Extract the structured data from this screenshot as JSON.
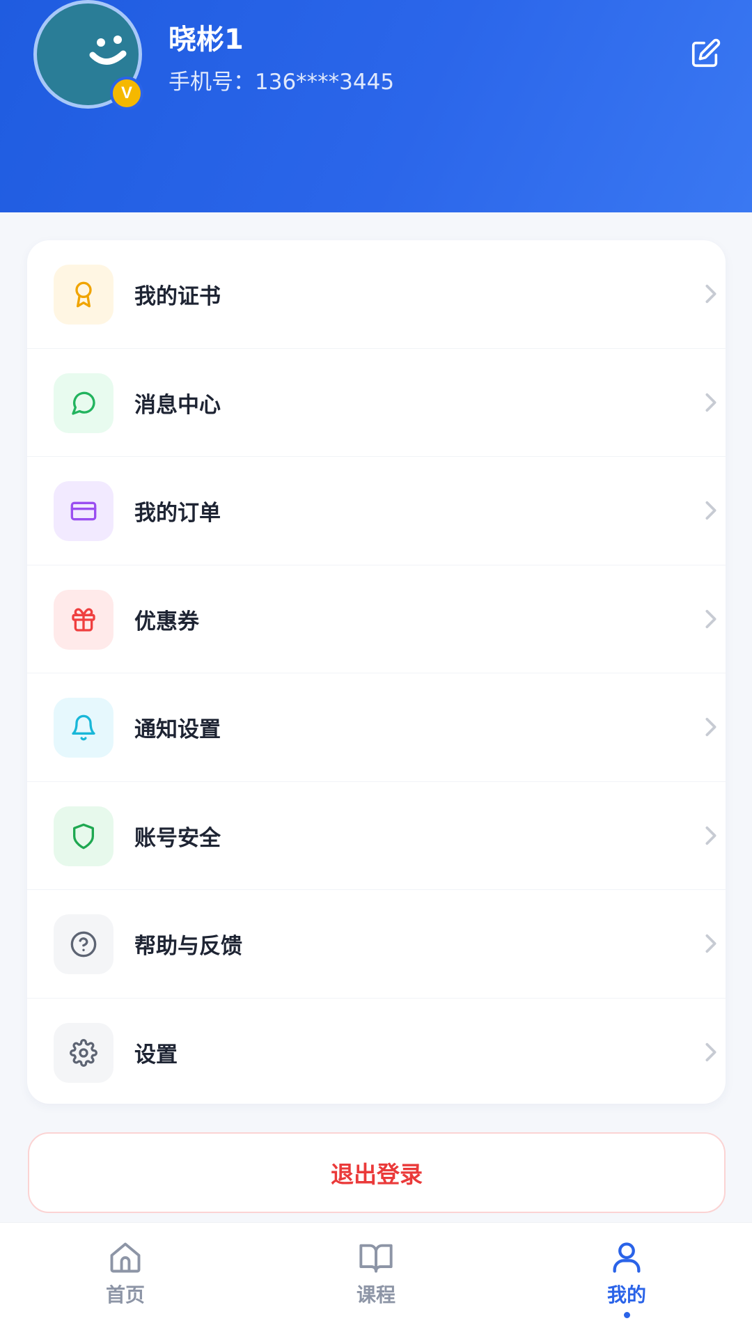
{
  "header": {
    "username": "晓彬1",
    "phone": "手机号：136****3445",
    "vip_badge": "V"
  },
  "menu": {
    "items": [
      {
        "label": "我的证书",
        "icon": "certificate-icon",
        "bg": "#fff6e3",
        "color": "#f0a400"
      },
      {
        "label": "消息中心",
        "icon": "chat-bubble-icon",
        "bg": "#e8fbef",
        "color": "#22b35e"
      },
      {
        "label": "我的订单",
        "icon": "credit-card-icon",
        "bg": "#f2eaff",
        "color": "#9a4ef0"
      },
      {
        "label": "优惠券",
        "icon": "gift-icon",
        "bg": "#ffeaea",
        "color": "#ef3f3f"
      },
      {
        "label": "通知设置",
        "icon": "bell-icon",
        "bg": "#e6f8fd",
        "color": "#19b7d8"
      },
      {
        "label": "账号安全",
        "icon": "shield-icon",
        "bg": "#e7f9ec",
        "color": "#1fa851"
      },
      {
        "label": "帮助与反馈",
        "icon": "help-circle-icon",
        "bg": "#f4f5f7",
        "color": "#5d6473"
      },
      {
        "label": "设置",
        "icon": "gear-icon",
        "bg": "#f4f5f7",
        "color": "#5d6473"
      }
    ]
  },
  "logout_label": "退出登录",
  "tabbar": {
    "tabs": [
      {
        "label": "首页",
        "icon": "home-icon",
        "active": false
      },
      {
        "label": "课程",
        "icon": "book-icon",
        "active": false
      },
      {
        "label": "我的",
        "icon": "user-icon",
        "active": true
      }
    ]
  },
  "colors": {
    "primary": "#2a63e8",
    "danger": "#ea3a3a",
    "inactive": "#8d95a6"
  }
}
